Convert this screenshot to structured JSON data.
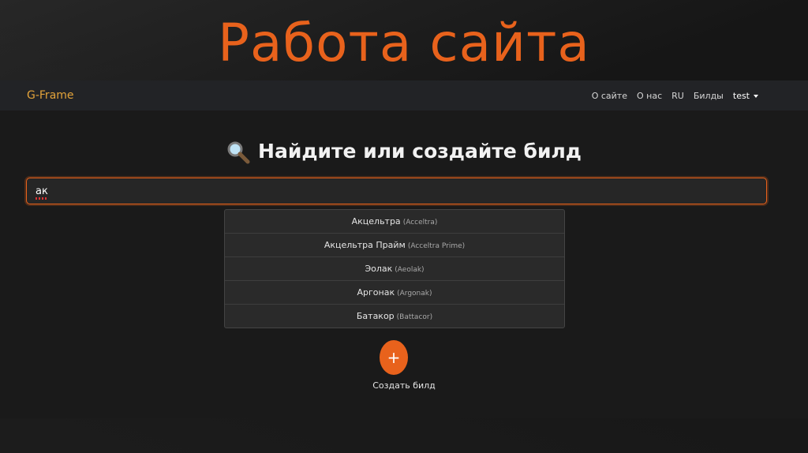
{
  "slide": {
    "title": "Работа сайта"
  },
  "navbar": {
    "brand": "G-Frame",
    "links": [
      "О сайте",
      "О нас",
      "RU",
      "Билды"
    ],
    "user": "test"
  },
  "main": {
    "heading": "Найдите или создайте билд",
    "search_value": "ак",
    "suggestions": [
      {
        "name": "Акцельтра",
        "original": "(Acceltra)"
      },
      {
        "name": "Акцельтра Прайм",
        "original": "(Acceltra Prime)"
      },
      {
        "name": "Эолак",
        "original": "(Aeolak)"
      },
      {
        "name": "Аргонак",
        "original": "(Argonak)"
      },
      {
        "name": "Батакор",
        "original": "(Battacor)"
      }
    ],
    "create_button_symbol": "+",
    "create_label": "Создать билд"
  },
  "colors": {
    "accent": "#e8621c",
    "brand": "#e3a33a",
    "background": "#1a1a1a"
  }
}
